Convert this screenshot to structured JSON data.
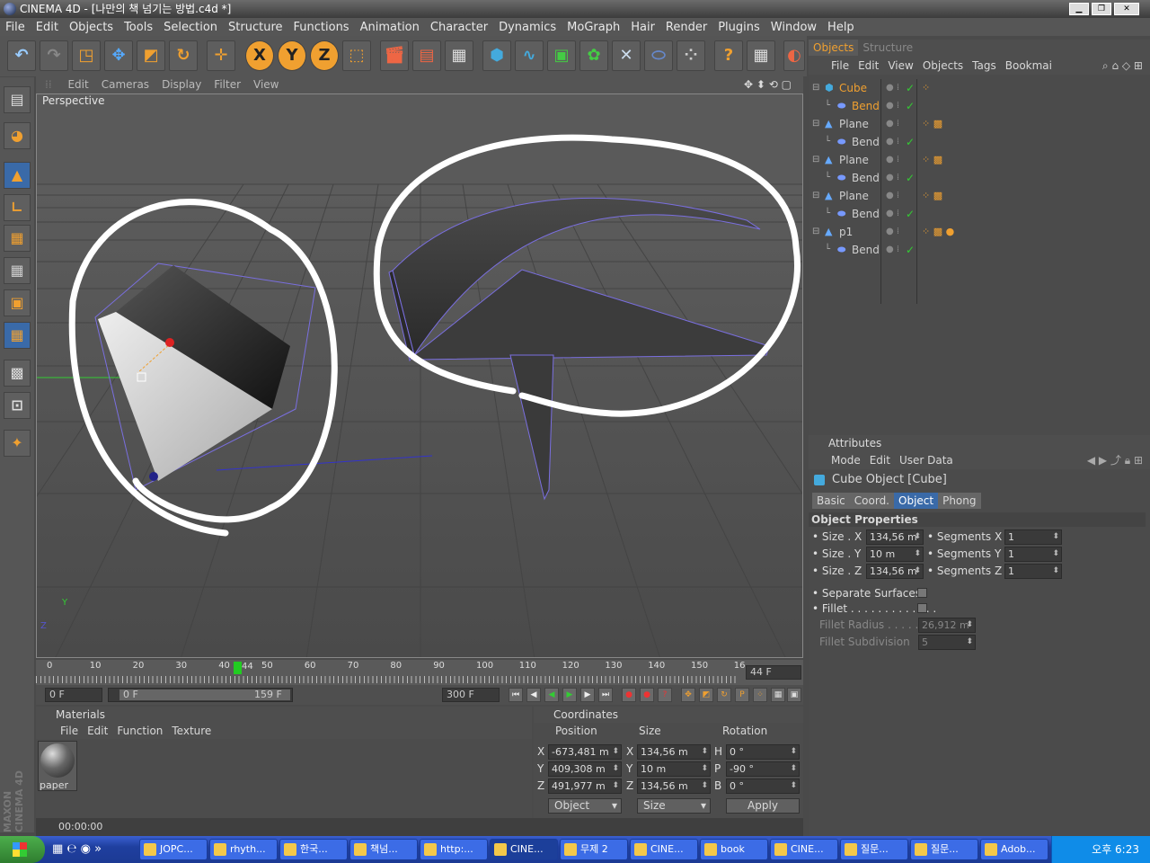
{
  "window": {
    "title": "CINEMA 4D - [나만의 책 넘기는 방법.c4d *]"
  },
  "menu": [
    "File",
    "Edit",
    "Objects",
    "Tools",
    "Selection",
    "Structure",
    "Functions",
    "Animation",
    "Character",
    "Dynamics",
    "MoGraph",
    "Hair",
    "Render",
    "Plugins",
    "Window",
    "Help"
  ],
  "toolbar": {
    "icons": [
      "undo-icon",
      "redo-icon",
      "live-select-icon",
      "move-icon",
      "scale-icon",
      "rotate-icon",
      "move-tool-icon",
      "x-axis-icon",
      "y-axis-icon",
      "z-axis-icon",
      "coordinate-system-icon",
      "render-view-icon",
      "render-picture-icon",
      "render-settings-icon",
      "cube-icon",
      "spline-icon",
      "nurbs-icon",
      "array-icon",
      "deformer-icon",
      "scene-icon",
      "particle-icon",
      "help-icon",
      "spreadsheet-icon"
    ],
    "x_label": "X",
    "y_label": "Y",
    "z_label": "Z"
  },
  "viewport": {
    "menu": [
      "Edit",
      "Cameras",
      "Display",
      "Filter",
      "View"
    ],
    "label": "Perspective",
    "axis_y": "Y",
    "axis_z": "Z"
  },
  "timeline": {
    "ticks": [
      "0",
      "10",
      "20",
      "30",
      "40",
      "50",
      "60",
      "70",
      "80",
      "90",
      "100",
      "110",
      "120",
      "130",
      "140",
      "150",
      "16"
    ],
    "current_marker": "44",
    "current_frame": "44 F"
  },
  "playback": {
    "start": "0 F",
    "range_start": "0 F",
    "range_end": "159 F",
    "end": "300 F"
  },
  "materials": {
    "title": "Materials",
    "menu": [
      "File",
      "Edit",
      "Function",
      "Texture"
    ],
    "items": [
      {
        "name": "paper"
      }
    ]
  },
  "coordinates": {
    "title": "Coordinates",
    "headers": [
      "Position",
      "Size",
      "Rotation"
    ],
    "rows": [
      {
        "axis": "X",
        "pos": "-673,481 m",
        "saxis": "X",
        "size": "134,56 m",
        "raxis": "H",
        "rot": "0 °"
      },
      {
        "axis": "Y",
        "pos": "409,308 m",
        "saxis": "Y",
        "size": "10 m",
        "raxis": "P",
        "rot": "-90 °"
      },
      {
        "axis": "Z",
        "pos": "491,977 m",
        "saxis": "Z",
        "size": "134,56 m",
        "raxis": "B",
        "rot": "0 °"
      }
    ],
    "mode": "Object",
    "size_mode": "Size",
    "apply": "Apply"
  },
  "status": {
    "time": "00:00:00"
  },
  "objects_panel": {
    "tabs": [
      "Objects",
      "Structure"
    ],
    "menu": [
      "File",
      "Edit",
      "View",
      "Objects",
      "Tags",
      "Bookmai"
    ],
    "items": [
      {
        "name": "Cube",
        "level": 0,
        "color": "#f0a030"
      },
      {
        "name": "Bend",
        "level": 1,
        "color": "#f0a030"
      },
      {
        "name": "Plane",
        "level": 0,
        "color": "#cfcfcf"
      },
      {
        "name": "Bend",
        "level": 1,
        "color": "#cfcfcf"
      },
      {
        "name": "Plane",
        "level": 0,
        "color": "#cfcfcf"
      },
      {
        "name": "Bend",
        "level": 1,
        "color": "#cfcfcf"
      },
      {
        "name": "Plane",
        "level": 0,
        "color": "#cfcfcf"
      },
      {
        "name": "Bend",
        "level": 1,
        "color": "#cfcfcf"
      },
      {
        "name": "p1",
        "level": 0,
        "color": "#cfcfcf"
      },
      {
        "name": "Bend",
        "level": 1,
        "color": "#cfcfcf"
      }
    ]
  },
  "attributes": {
    "title": "Attributes",
    "menu": [
      "Mode",
      "Edit",
      "User Data"
    ],
    "object_title": "Cube Object [Cube]",
    "tabs": [
      "Basic",
      "Coord.",
      "Object",
      "Phong"
    ],
    "active_tab": "Object",
    "section": "Object Properties",
    "props": [
      {
        "label": "Size . X",
        "value": "134,56 m",
        "seg_label": "Segments X",
        "seg": "1"
      },
      {
        "label": "Size . Y",
        "value": "10 m",
        "seg_label": "Segments Y",
        "seg": "1"
      },
      {
        "label": "Size . Z",
        "value": "134,56 m",
        "seg_label": "Segments Z",
        "seg": "1"
      }
    ],
    "separate_surfaces": "Separate Surfaces",
    "fillet": "Fillet . . . . . . . . . . . . .",
    "fillet_radius": "Fillet Radius . . . . .",
    "fillet_radius_value": "26,912 m",
    "fillet_subdivision": "Fillet Subdivision",
    "fillet_subdivision_value": "5"
  },
  "brand": "MAXON CINEMA 4D",
  "taskbar": {
    "items": [
      "JOPC...",
      "rhyth...",
      "한국...",
      "책넘...",
      "http:...",
      "CINE...",
      "무제 2",
      "CINE...",
      "book",
      "CINE...",
      "질문...",
      "질문...",
      "Adob..."
    ],
    "active_index": 5,
    "clock": "오후 6:23"
  }
}
